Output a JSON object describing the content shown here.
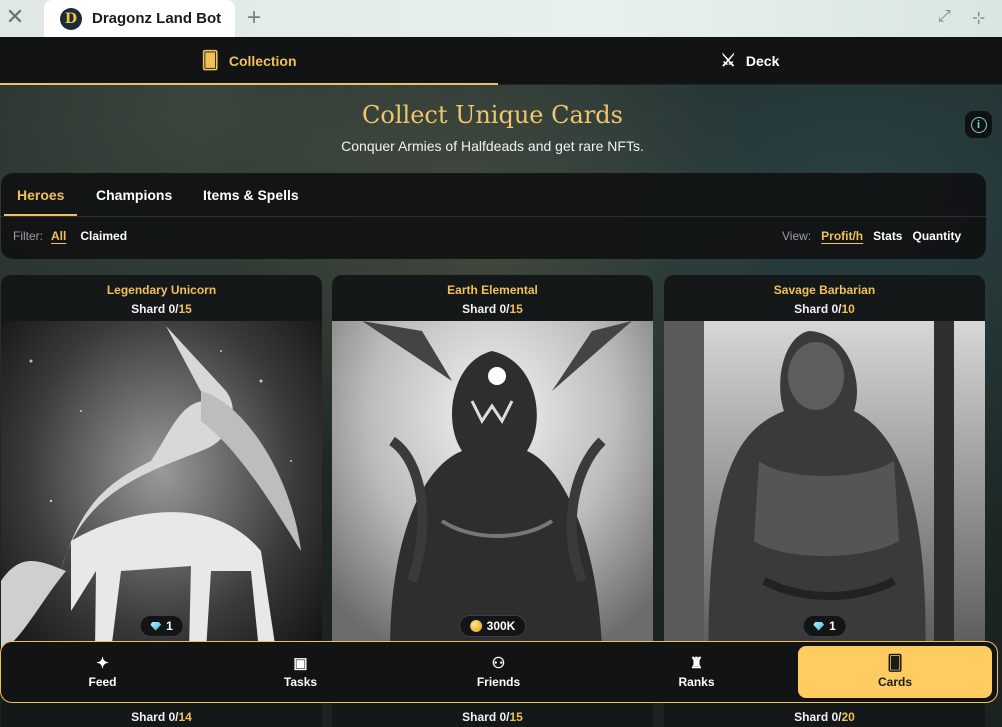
{
  "browser": {
    "tab_title": "Dragonz Land Bot",
    "tab_logo_letter": "D",
    "close_glyph": "✕",
    "new_tab_glyph": "+",
    "restore_glyph": "⤢",
    "collapse_glyph": "⊹"
  },
  "topnav": {
    "items": [
      {
        "label": "Collection",
        "icon": "cards-icon",
        "glyph": "🂠",
        "active": true
      },
      {
        "label": "Deck",
        "icon": "crossed-swords-icon",
        "glyph": "⚔",
        "active": false
      }
    ]
  },
  "hero": {
    "title": "Collect Unique Cards",
    "subtitle": "Conquer Armies of Halfdeads and get rare NFTs.",
    "info_glyph": "i"
  },
  "categories": [
    {
      "label": "Heroes",
      "active": true
    },
    {
      "label": "Champions",
      "active": false
    },
    {
      "label": "Items & Spells",
      "active": false
    }
  ],
  "filter": {
    "label": "Filter:",
    "options": [
      {
        "label": "All",
        "active": true
      },
      {
        "label": "Claimed",
        "active": false
      }
    ]
  },
  "view": {
    "label": "View:",
    "options": [
      {
        "label": "Profit/h",
        "active": true
      },
      {
        "label": "Stats",
        "active": false
      },
      {
        "label": "Quantity",
        "active": false
      }
    ]
  },
  "cards": [
    {
      "name": "Legendary Unicorn",
      "shard_prefix": "Shard 0/",
      "shard_max": "15",
      "badge_icon": "gem-icon",
      "badge_value": "1"
    },
    {
      "name": "Earth Elemental",
      "shard_prefix": "Shard 0/",
      "shard_max": "15",
      "badge_icon": "coin-icon",
      "badge_value": "300K"
    },
    {
      "name": "Savage Barbarian",
      "shard_prefix": "Shard 0/",
      "shard_max": "10",
      "badge_icon": "gem-icon",
      "badge_value": "1"
    }
  ],
  "cards_row2": [
    {
      "shard_prefix": "Shard 0/",
      "shard_max": "14"
    },
    {
      "shard_prefix": "Shard 0/",
      "shard_max": "15"
    },
    {
      "shard_prefix": "Shard 0/",
      "shard_max": "20"
    }
  ],
  "bottomnav": {
    "items": [
      {
        "label": "Feed",
        "icon": "magic-wand-icon",
        "glyph": "✦",
        "active": false
      },
      {
        "label": "Tasks",
        "icon": "calendar-check-icon",
        "glyph": "▣",
        "active": false
      },
      {
        "label": "Friends",
        "icon": "friends-icon",
        "glyph": "⚇",
        "active": false
      },
      {
        "label": "Ranks",
        "icon": "trophy-icon",
        "glyph": "♜",
        "active": false
      },
      {
        "label": "Cards",
        "icon": "cards-icon",
        "glyph": "🂠",
        "active": true
      }
    ]
  },
  "colors": {
    "accent": "#f0c15b",
    "active_nav_bg": "#ffcc61",
    "panel": "#111314"
  }
}
